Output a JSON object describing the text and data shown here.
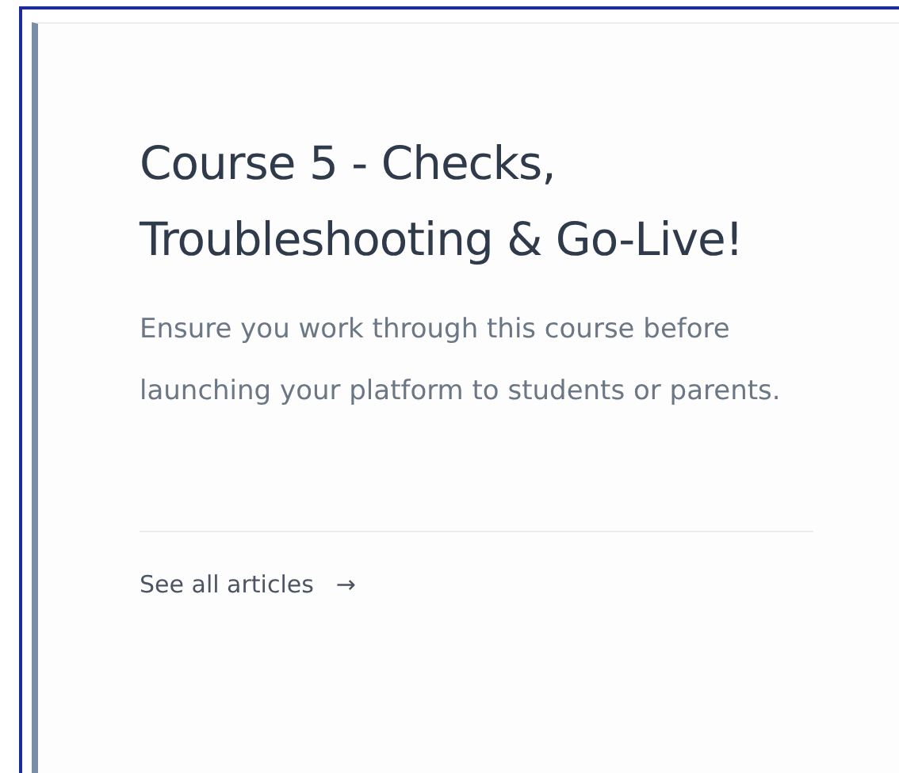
{
  "card": {
    "title": "Course 5 - Checks, Troubleshooting & Go-Live!",
    "description": "Ensure you work through this course before launching your platform to students or parents.",
    "link": {
      "label": "See all articles",
      "arrow": "→"
    }
  }
}
